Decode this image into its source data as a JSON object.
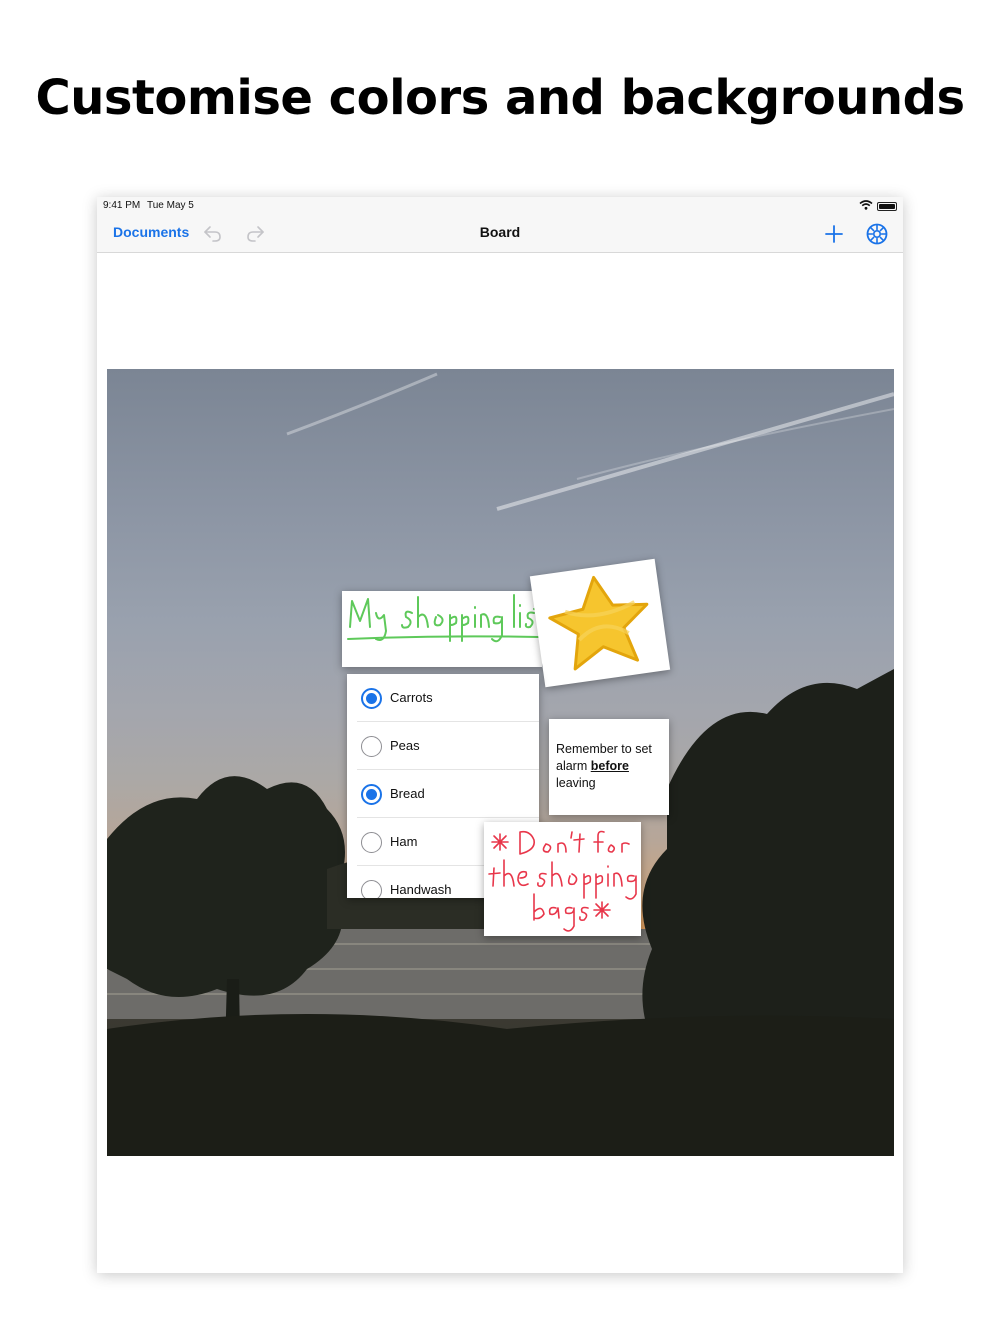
{
  "headline": "Customise colors and backgrounds",
  "status": {
    "time": "9:41 PM",
    "date": "Tue May 5"
  },
  "nav": {
    "back_label": "Documents",
    "title": "Board"
  },
  "notes": {
    "title_handwritten": "My shopping list",
    "checklist": [
      {
        "label": "Carrots",
        "checked": true
      },
      {
        "label": "Peas",
        "checked": false
      },
      {
        "label": "Bread",
        "checked": true
      },
      {
        "label": "Ham",
        "checked": false
      },
      {
        "label": "Handwash",
        "checked": false
      }
    ],
    "reminder_before": "Remember to set alarm ",
    "reminder_bold": "before",
    "reminder_after": " leaving",
    "red_note_handwritten": "* Don't forget the shopping bags *"
  },
  "colors": {
    "accent": "#1a73e8",
    "handwriting_green": "#5ec95a",
    "handwriting_red": "#e8364a",
    "star_yellow": "#f5c01c"
  },
  "icons": [
    "undo-icon",
    "redo-icon",
    "plus-icon",
    "settings-icon",
    "wifi-icon",
    "battery-icon",
    "star-drawing"
  ]
}
